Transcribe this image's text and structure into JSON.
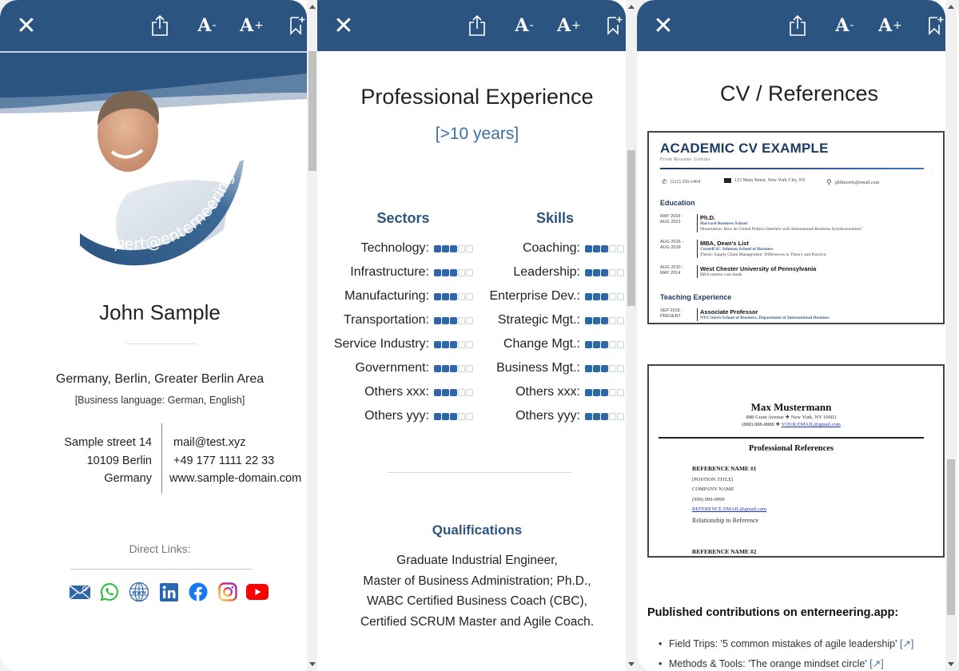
{
  "toolbar": {
    "close_icon": "close-icon",
    "share_icon": "share-icon",
    "font_decrease": "A",
    "font_decrease_sup": "-",
    "font_increase": "A",
    "font_increase_sup": "+",
    "bookmark_icon": "bookmark-add-icon"
  },
  "profile": {
    "badge_text": "expert@enterneering",
    "name": "John Sample",
    "location": "Germany, Berlin, Greater Berlin Area",
    "languages": "[Business language: German, English]",
    "address": [
      "Sample street 14",
      "10109 Berlin",
      "Germany"
    ],
    "email": "mail@test.xyz",
    "phone": "+49 177 1111 22 33",
    "website": "www.sample-domain.com",
    "direct_links_label": "Direct Links:",
    "social_links": [
      {
        "name": "email",
        "color": "#2e67a8"
      },
      {
        "name": "whatsapp",
        "color": "#25c13a"
      },
      {
        "name": "website",
        "color": "#2e67a8"
      },
      {
        "name": "linkedin",
        "color": "#2867b2"
      },
      {
        "name": "facebook",
        "color": "#1877f2"
      },
      {
        "name": "instagram",
        "color": "#d6249f"
      },
      {
        "name": "youtube",
        "color": "#ff0000"
      }
    ]
  },
  "experience": {
    "title": "Professional Experience",
    "years": "[>10 years]",
    "rating_max": 5,
    "sectors_title": "Sectors",
    "sectors": [
      {
        "label": "Technology:",
        "rating": 3
      },
      {
        "label": "Infrastructure:",
        "rating": 3
      },
      {
        "label": "Manufacturing:",
        "rating": 3
      },
      {
        "label": "Transportation:",
        "rating": 3
      },
      {
        "label": "Service Industry:",
        "rating": 3
      },
      {
        "label": "Government:",
        "rating": 3
      },
      {
        "label": "Others xxx:",
        "rating": 3
      },
      {
        "label": "Others yyy:",
        "rating": 3
      }
    ],
    "skills_title": "Skills",
    "skills": [
      {
        "label": "Coaching:",
        "rating": 3
      },
      {
        "label": "Leadership:",
        "rating": 3
      },
      {
        "label": "Enterprise Dev.:",
        "rating": 3
      },
      {
        "label": "Strategic Mgt.:",
        "rating": 3
      },
      {
        "label": "Change Mgt.:",
        "rating": 3
      },
      {
        "label": "Business Mgt.:",
        "rating": 3
      },
      {
        "label": "Others xxx:",
        "rating": 3
      },
      {
        "label": "Others yyy:",
        "rating": 3
      }
    ],
    "qualifications_title": "Qualifications",
    "qualifications": [
      "Graduate Industrial Engineer,",
      "Master of Business Administration; Ph.D.,",
      "WABC Certified Business Coach (CBC),",
      "Certified SCRUM Master and Agile Coach."
    ]
  },
  "references": {
    "title": "CV / References",
    "cv": {
      "title": "ACADEMIC CV EXAMPLE",
      "subtitle": "From Resume Genius",
      "phone": "(212) 256-1464",
      "address": "123 Main Street, New York City, NY",
      "email": "philmorris@email.com",
      "education_heading": "Education",
      "education": [
        {
          "date": "MAY 2018 - AUG 2021",
          "role": "Ph.D.",
          "institution": "Harvard Business School",
          "note": "Dissertation: How do Global Politics Interfere with International Business Synchronization?"
        },
        {
          "date": "AUG 2016 - AUG 2018",
          "role": "MBA, Dean's List",
          "institution": "Cornell SC Johnson School of Business",
          "note": "Thesis: Supply Chain Management: Differences in Theory and Practice."
        },
        {
          "date": "AUG 2010 - MAY 2014",
          "role": "West Chester University of Pennsylvania",
          "institution": "",
          "note": "BBA summa cum laude"
        }
      ],
      "teaching_heading": "Teaching Experience",
      "teaching": [
        {
          "date": "SEP 2018 - PRESENT",
          "role": "Associate Professor",
          "institution": "NYU Stern School of Business, Department of International Business",
          "note": ""
        }
      ]
    },
    "ref_doc": {
      "name": "Max Mustermann",
      "address_line": "888 Grant Avenue ❖ New York, NY 10603",
      "phone": "(888) 888-8888 ❖ ",
      "email": "YOUR.EMAIL@gmail.com",
      "heading": "Professional References",
      "ref1_name": "REFERENCE NAME #1",
      "ref1_title": "[POSTION TITLE]",
      "ref1_company": "COMPANY NAME",
      "ref1_phone": "(999) 999-9999",
      "ref1_email": "REFERENCE.EMAIL@gmail.com",
      "ref1_relationship": "Relationship to Reference",
      "ref2_name": "REFERENCE NAME #2"
    },
    "published_heading": "Published contributions on enterneering.app:",
    "published": [
      {
        "text": "Field Trips: '5 common mistakes of agile leadership' ",
        "link": "[↗]"
      },
      {
        "text": "Methods & Tools: 'The orange mindset circle' ",
        "link": "[↗]"
      }
    ]
  }
}
